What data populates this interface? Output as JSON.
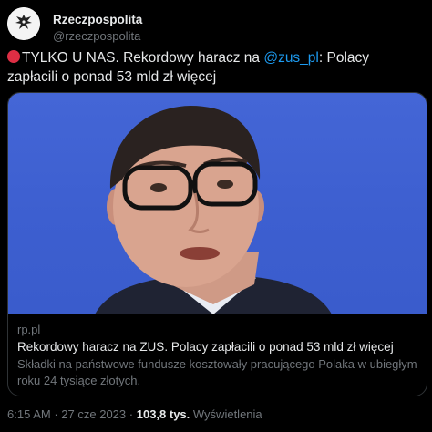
{
  "account": {
    "name": "Rzeczpospolita",
    "handle": "@rzeczpospolita"
  },
  "tweet": {
    "emoji": "red-circle",
    "text_prefix": "TYLKO U NAS. Rekordowy haracz na ",
    "mention": "@zus_pl",
    "text_suffix": ": Polacy zapłacili o ponad 53 mld zł więcej"
  },
  "card": {
    "domain": "rp.pl",
    "title": "Rekordowy haracz na ZUS. Polacy zapłacili o ponad 53 mld zł więcej",
    "description": "Składki na państwowe fundusze kosztowały pracującego Polaka w ubiegłym roku 24 tysiące złotych."
  },
  "meta": {
    "time": "6:15 AM",
    "separator": "·",
    "date": "27 cze 2023",
    "views_count": "103,8 tys.",
    "views_label": "Wyświetlenia"
  },
  "colors": {
    "background": "#000000",
    "text": "#e7e9ea",
    "secondary": "#71767b",
    "link": "#1d9bf0",
    "border": "#2f3336",
    "photo_background": "#4466d6"
  }
}
